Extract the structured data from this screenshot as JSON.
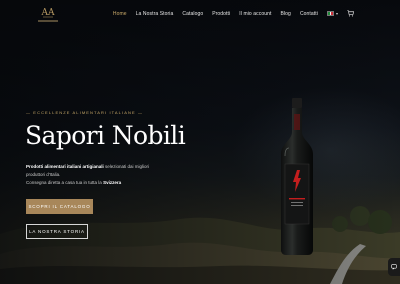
{
  "header": {
    "logo_text": "AA",
    "nav": [
      {
        "label": "Home",
        "active": true
      },
      {
        "label": "La Nostra Storia",
        "active": false
      },
      {
        "label": "Catalogo",
        "active": false
      },
      {
        "label": "Prodotti",
        "active": false
      },
      {
        "label": "Il mio account",
        "active": false
      },
      {
        "label": "Blog",
        "active": false
      },
      {
        "label": "Contatti",
        "active": false
      }
    ],
    "language_icon": "italy-flag-icon",
    "cart_icon": "cart-icon"
  },
  "hero": {
    "eyebrow": "— ECCELLENZE ALIMENTARI ITALIANE —",
    "title": "Sapori Nobili",
    "desc_line1_bold": "Prodotti alimentari italiani artigianali",
    "desc_line1_rest": " selezionati dai migliori",
    "desc_line2": "produttori d'Italia.",
    "desc_line3_pre": "Consegna diretta a casa tua in tutta la ",
    "desc_line3_bold": "Svizzera",
    "primary_button": "SCOPRI IL CATALOGO",
    "secondary_button": "LA NOSTRA STORIA"
  },
  "colors": {
    "accent": "#c9a969",
    "button": "#a8875a",
    "background": "#0b0e13",
    "bottle_label": "#c41e1e"
  }
}
